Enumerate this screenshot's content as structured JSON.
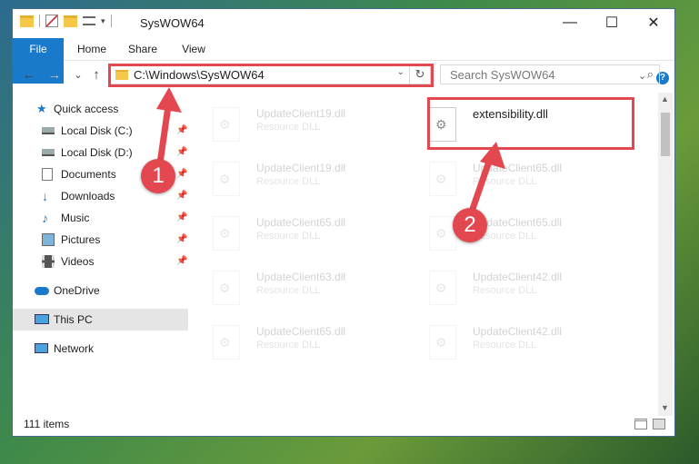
{
  "window": {
    "title": "SysWOW64",
    "controls": {
      "minimize": "—",
      "maximize": "☐",
      "close": "✕"
    }
  },
  "ribbon": {
    "tabs": [
      "File",
      "Home",
      "Share",
      "View"
    ]
  },
  "navigation": {
    "back": "←",
    "forward": "→",
    "recent": "⌄",
    "up": "↑"
  },
  "address": {
    "path": "C:\\Windows\\SysWOW64",
    "dropdown": "⌄",
    "refresh": "↻"
  },
  "search": {
    "placeholder": "Search SysWOW64",
    "icon": "⌕"
  },
  "sidebar": {
    "items": [
      {
        "label": "Quick access",
        "icon": "star-icon"
      },
      {
        "label": "Local Disk (C:)",
        "icon": "drive-icon",
        "pinned": true
      },
      {
        "label": "Local Disk (D:)",
        "icon": "drive-icon",
        "pinned": true
      },
      {
        "label": "Documents",
        "icon": "documents-icon",
        "pinned": true
      },
      {
        "label": "Downloads",
        "icon": "download-icon",
        "pinned": true
      },
      {
        "label": "Music",
        "icon": "music-icon",
        "pinned": true
      },
      {
        "label": "Pictures",
        "icon": "pictures-icon",
        "pinned": true
      },
      {
        "label": "Videos",
        "icon": "videos-icon",
        "pinned": true
      },
      {
        "label": "OneDrive",
        "icon": "cloud-icon"
      },
      {
        "label": "This PC",
        "icon": "computer-icon",
        "selected": true
      },
      {
        "label": "Network",
        "icon": "network-icon"
      }
    ]
  },
  "files": {
    "left": [
      {
        "name": "UpdateClient19.dll",
        "type": "Resource DLL"
      },
      {
        "name": "UpdateClient19.dll",
        "type": "Resource DLL"
      },
      {
        "name": "UpdateClient65.dll",
        "type": "Resource DLL"
      },
      {
        "name": "UpdateClient63.dll",
        "type": "Resource DLL"
      },
      {
        "name": "UpdateClient65.dll",
        "type": "Resource DLL"
      }
    ],
    "right": [
      {
        "name": "extensibility.dll",
        "type": ""
      },
      {
        "name": "UpdateClient65.dll",
        "type": "Resource DLL"
      },
      {
        "name": "UpdateClient65.dll",
        "type": "Resource DLL"
      },
      {
        "name": "UpdateClient42.dll",
        "type": "Resource DLL"
      },
      {
        "name": "UpdateClient42.dll",
        "type": "Resource DLL"
      }
    ]
  },
  "status": {
    "count": "111 items"
  },
  "callouts": {
    "one": "1",
    "two": "2"
  },
  "colors": {
    "accent": "#1979ca",
    "highlight": "#e3474f"
  }
}
